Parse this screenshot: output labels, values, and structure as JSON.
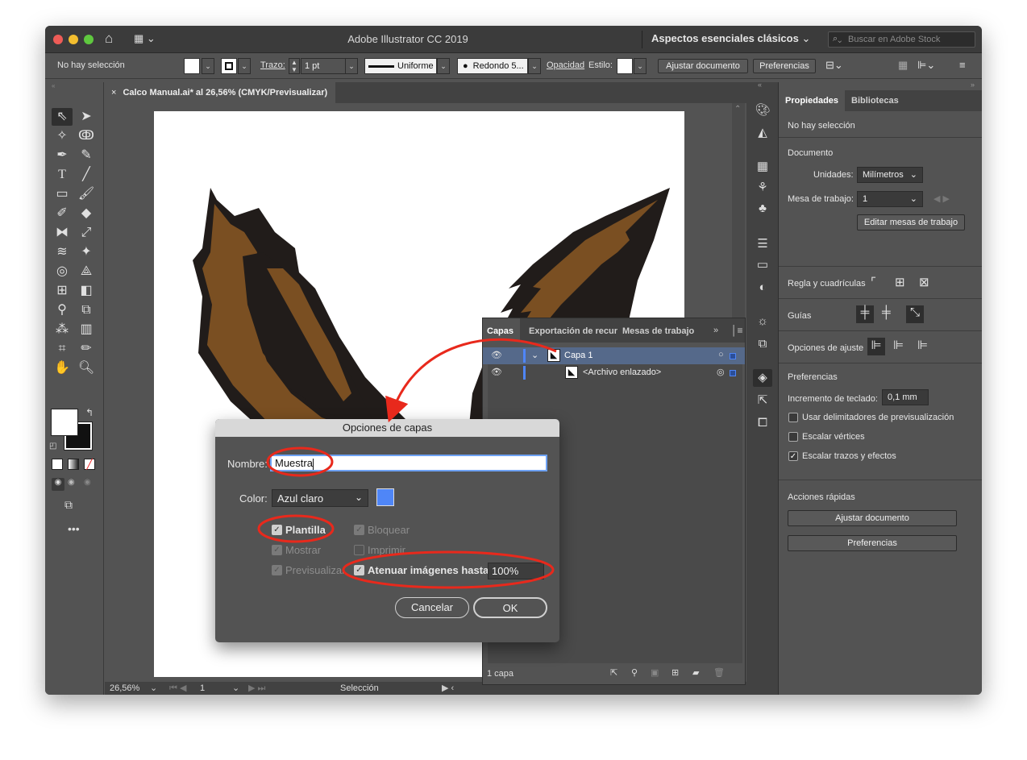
{
  "window": {
    "title": "Adobe Illustrator CC 2019",
    "workspace": "Aspectos esenciales clásicos",
    "stock_placeholder": "Buscar en Adobe Stock"
  },
  "control_bar": {
    "selection": "No hay selección",
    "stroke_label": "Trazo:",
    "stroke_value": "1 pt",
    "profile": "Uniforme",
    "brush": "Redondo 5...",
    "opacity_label": "Opacidad",
    "style_label": "Estilo:",
    "ajustar_btn": "Ajustar documento",
    "prefs_btn": "Preferencias"
  },
  "document_tab": {
    "close": "×",
    "title": "Calco Manual.ai* al 26,56% (CMYK/Previsualizar)"
  },
  "status_bar": {
    "zoom": "26,56%",
    "artboard": "1",
    "tool": "Selección"
  },
  "properties_panel": {
    "tabs": [
      "Propiedades",
      "Bibliotecas"
    ],
    "no_selection": "No hay selección",
    "document_heading": "Documento",
    "units_label": "Unidades:",
    "units_value": "Milímetros",
    "artboard_label": "Mesa de trabajo:",
    "artboard_value": "1",
    "edit_artboards_btn": "Editar mesas de trabajo",
    "rulers_label": "Regla y cuadrículas",
    "guides_label": "Guías",
    "snap_label": "Opciones de ajuste",
    "prefs_heading": "Preferencias",
    "keyboard_inc_label": "Incremento de teclado:",
    "keyboard_inc_value": "0,1 mm",
    "check_preview_bounds": "Usar delimitadores de previsualización",
    "check_scale_corners": "Escalar vértices",
    "check_scale_strokes": "Escalar trazos y efectos",
    "quick_actions_heading": "Acciones rápidas",
    "quick_ajustar": "Ajustar documento",
    "quick_prefs": "Preferencias"
  },
  "layers_panel": {
    "tabs": [
      "Capas",
      "Exportación de recur",
      "Mesas de trabajo"
    ],
    "rows": [
      {
        "name": "Capa 1"
      },
      {
        "name": "<Archivo enlazado>"
      }
    ],
    "footer_count": "1 capa"
  },
  "dialog": {
    "title": "Opciones de capas",
    "name_label": "Nombre:",
    "name_value": "Muestra",
    "color_label": "Color:",
    "color_value": "Azul claro",
    "color_swatch": "#4f86f7",
    "plantilla": "Plantilla",
    "bloquear": "Bloquear",
    "mostrar": "Mostrar",
    "imprimir": "Imprimir",
    "previsualizar": "Previsualizar",
    "atenuar": "Atenuar imágenes hasta:",
    "atenuar_value": "100%",
    "cancel": "Cancelar",
    "ok": "OK"
  },
  "colors": {
    "ui_bg": "#535353",
    "annotation": "#e8291c",
    "wing_brown": "#7a4f22",
    "wing_dark": "#211c1a",
    "layer_blue": "#4f86f7"
  }
}
